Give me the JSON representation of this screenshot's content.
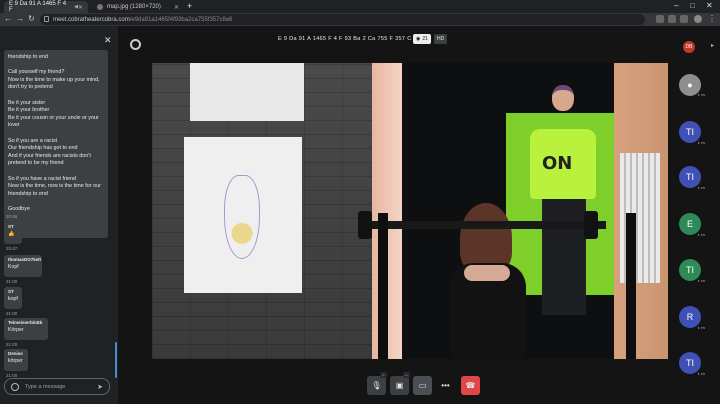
{
  "browser": {
    "tabs": [
      {
        "title": "E 9 Da 91 A 1465 F 4 F",
        "active": true
      },
      {
        "title": "map.jpg (1280×720)",
        "active": false
      }
    ],
    "url_host": "meet.cobratheatercobra.com",
    "url_path": "/e9da91a1465f4f93ba2ca755f357c8a6"
  },
  "chat": {
    "long_message": "friendship to end\n\nCall yourself my friend?\nNow is the time to make up your mind,\ndon't try to pretend\n\nBe it your sister\nBe it your brother\nBe it your cousin or your uncle or your\nlover\n\nSo if you are a racist\nOur friendship has got to end\nAnd if your friends are racists don't\npretend to be my friend\n\nSo if you have a racist friend\nNow is the time, now is the time for our\nfriendship to end\n\nGoodbye",
    "messages": [
      {
        "time": "20:46",
        "sender": "ST",
        "text": "👍"
      },
      {
        "time": "20:47",
        "sender": "thomasDO7kelt",
        "text": "Kopf"
      },
      {
        "time": "21:00",
        "sender": "ST",
        "text": "kopf"
      },
      {
        "time": "21:00",
        "sender": "Teimeimerbit4tb",
        "text": "Körper"
      },
      {
        "time": "21:00",
        "sender": "Denise",
        "text": "körper"
      },
      {
        "time": "21:00",
        "sender": "",
        "text": ""
      }
    ],
    "input_placeholder": "Type a message"
  },
  "room": {
    "title": "E 9 Da 91 A 1465 F 4 F 93 Ba 2 Ca 755 F 357 C 8 A 6",
    "participant_count": "21",
    "quality": "HD"
  },
  "participants": [
    {
      "initials": "DB",
      "color": "#c0392b"
    },
    {
      "initials": "",
      "color": "#8e8e8e"
    },
    {
      "initials": "TI",
      "color": "#3f51b5"
    },
    {
      "initials": "TI",
      "color": "#3f51b5"
    },
    {
      "initials": "E",
      "color": "#2e8b57"
    },
    {
      "initials": "TI",
      "color": "#2e8b57"
    },
    {
      "initials": "R",
      "color": "#3f51b5"
    },
    {
      "initials": "TI",
      "color": "#3f51b5"
    }
  ],
  "participant_sublabel": "t. m"
}
